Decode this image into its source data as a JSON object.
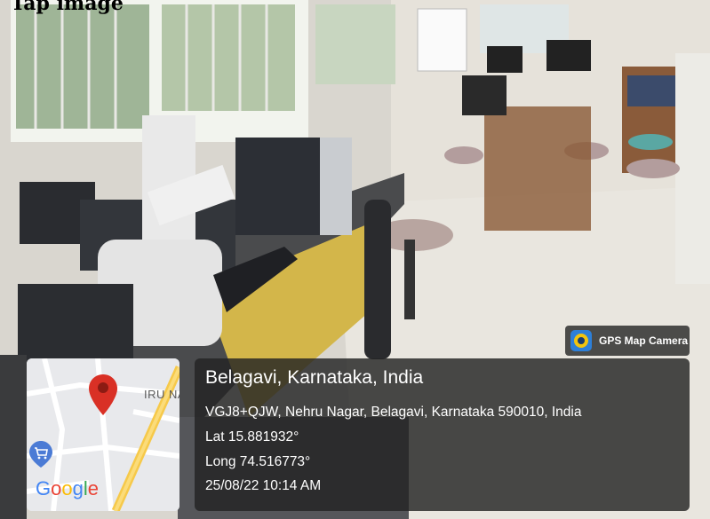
{
  "caption": {
    "text": "Tap image"
  },
  "badge": {
    "label": "GPS Map Camera",
    "icon": "gps-map-camera-icon"
  },
  "location": {
    "place": "Belagavi, Karnataka, India",
    "address": "VGJ8+QJW, Nehru Nagar, Belagavi, Karnataka 590010, India",
    "lat": "Lat 15.881932°",
    "long": "Long 74.516773°",
    "datetime": "25/08/22 10:14 AM"
  },
  "map": {
    "street_label": "IRU NAGA",
    "brand": [
      "G",
      "o",
      "o",
      "g",
      "l",
      "e"
    ],
    "pin_color": "#d93025"
  }
}
